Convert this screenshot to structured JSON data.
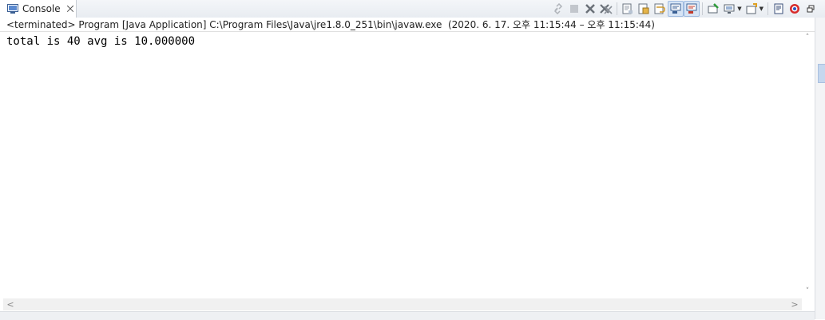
{
  "tab": {
    "label": "Console",
    "icon": "console-icon",
    "close_icon": "close-icon"
  },
  "toolbar": {
    "icons": [
      "link-icon",
      "stop-icon",
      "remove-launch-icon",
      "remove-all-terminated-icon",
      "clear-console-icon",
      "scroll-lock-icon",
      "word-wrap-icon",
      "show-on-stdout-icon",
      "show-on-stderr-icon",
      "pin-console-icon",
      "display-selected-console-icon",
      "open-console-icon",
      "sign-icon",
      "target-icon",
      "minimize-icon"
    ]
  },
  "console": {
    "header": "<terminated> Program [Java Application] C:\\Program Files\\Java\\jre1.8.0_251\\bin\\javaw.exe  (2020. 6. 17. 오후 11:15:44 – 오후 11:15:44)",
    "output": "total is 40 avg is 10.000000"
  },
  "scroll": {
    "up": "˄",
    "down": "˅",
    "left": "<",
    "right": ">"
  },
  "colors": {
    "accent": "#d6e4f5",
    "background": "#ffffff",
    "text": "#000000"
  }
}
